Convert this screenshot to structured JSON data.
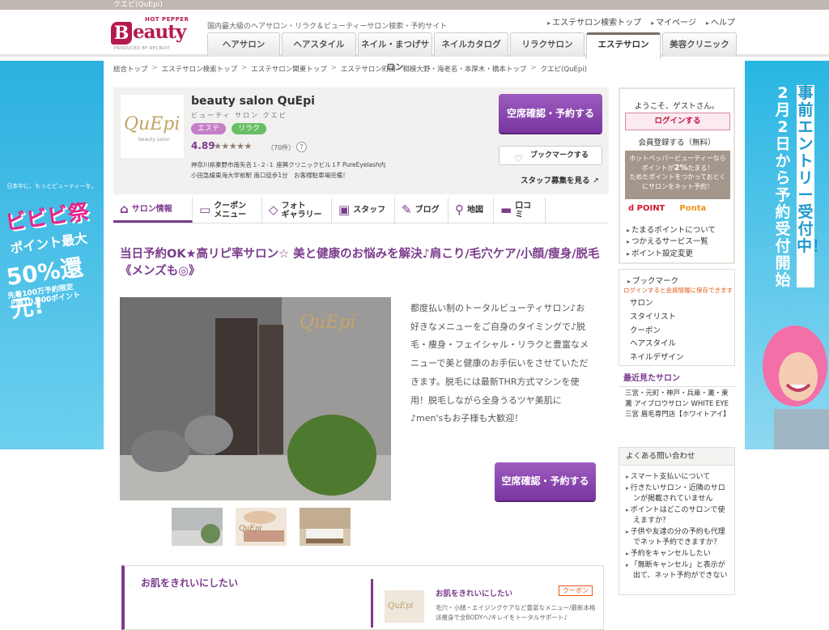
{
  "topbar": {
    "title": "クエピ(QuEpi)"
  },
  "header": {
    "logo": {
      "hotpepper": "HOT PEPPER",
      "b": "B",
      "eauty": "eauty",
      "produced": "PRODUCED BY RECRUIT"
    },
    "tagline": "国内最大級のヘアサロン・リラク＆ビューティーサロン検索・予約サイト",
    "links": [
      "エステサロン検索トップ",
      "マイページ",
      "ヘルプ"
    ],
    "tabs": [
      {
        "label": "ヘアサロン",
        "active": false
      },
      {
        "label": "ヘアスタイル",
        "active": false
      },
      {
        "label": "ネイル・まつげサロン",
        "active": false
      },
      {
        "label": "ネイルカタログ",
        "active": false
      },
      {
        "label": "リラクサロン",
        "active": false
      },
      {
        "label": "エステサロン",
        "active": true
      },
      {
        "label": "美容クリニック",
        "active": false
      }
    ]
  },
  "breadcrumb": [
    "総合トップ",
    "エステサロン検索トップ",
    "エステサロン関東トップ",
    "エステサロン町田・相模大野・海老名・本厚木・橋本トップ",
    "クエピ(QuEpi)"
  ],
  "salon": {
    "logo_text": "QuEpi",
    "logo_sub": "beauty salon",
    "name": "beauty salon QuEpi",
    "kana": "ビューティ サロン クエピ",
    "tags": [
      "エステ",
      "リラク"
    ],
    "rating": "4.89",
    "stars": "★★★★★",
    "reviews": "（70件）",
    "help": "?",
    "address": "神奈川県秦野市南矢名１-２-１ 座興クリニックビル１F PureEyelash内",
    "access": "小田急線東海大学前駅 南口徒歩1分　お客様駐車場完備！",
    "reserve_label": "空席確認・予約する",
    "bookmark_label": "ブックマークする",
    "staff_link": "スタッフ募集を見る"
  },
  "subnav": [
    {
      "label": "サロン情報",
      "icon": "home-icon",
      "glyph": "⌂",
      "active": true
    },
    {
      "label": "クーポン\nメニュー",
      "icon": "coupon-icon",
      "glyph": "▭",
      "active": false
    },
    {
      "label": "フォト\nギャラリー",
      "icon": "photo-icon",
      "glyph": "◇",
      "active": false
    },
    {
      "label": "スタッフ",
      "icon": "staff-icon",
      "glyph": "▣",
      "active": false
    },
    {
      "label": "ブログ",
      "icon": "pencil-icon",
      "glyph": "✎",
      "active": false
    },
    {
      "label": "地図",
      "icon": "map-pin-icon",
      "glyph": "⚲",
      "active": false
    },
    {
      "label": "口コミ",
      "icon": "speech-bubble-icon",
      "glyph": "▬",
      "active": false
    }
  ],
  "headline": "当日予約OK★高リピ率サロン☆ 美と健康のお悩みを解決♪肩こり/毛穴ケア/小顔/痩身/脱毛《メンズも◎》",
  "description": "都度払い制のトータルビューティサロン♪お好きなメニューをご自身のタイミングで♪脱毛・痩身・フェイシャル・リラクと豊富なメニューで美と健康のお手伝いをさせていただきます。脱毛には最新THR方式マシンを使用！脱毛しながら全身うるツヤ美肌に♪men'sもお子様も大歓迎！",
  "reserve_label_2": "空席確認・予約する",
  "feature": {
    "title": "お肌をきれいにしたい",
    "card_title": "お肌をきれいにしたい",
    "badge": "クーポン",
    "card_desc": "毛穴・小顔・エイジングケアなど豊富なメニュー/最新本格派痩身で全BODYへ/キレイをトータルサポート♪",
    "img_text": "QuEpi"
  },
  "sidebar": {
    "welcome": "ようこそ、ゲストさん。",
    "login": "ログインする",
    "register": "会員登録する（無料）",
    "points_line1": "ホットペッパービューティーなら",
    "points_line2": "ポイントが",
    "points_pct": "2%",
    "points_line3": "たまる！",
    "points_line4": "ためたポイントをつかっておとく",
    "points_line5": "にサロンをネット予約！",
    "dpoint": "d POINT",
    "ponta": "Ponta",
    "links": [
      "たまるポイントについて",
      "つかえるサービス一覧",
      "ポイント設定変更"
    ],
    "bookmark_title": "ブックマーク",
    "bookmark_note": "ログインすると会員情報に保存できます",
    "bookmark_items": [
      "サロン",
      "スタイリスト",
      "クーポン",
      "ヘアスタイル",
      "ネイルデザイン"
    ],
    "recent_title": "最近見たサロン",
    "recent_text": "三宮・元町・神戸・兵庫・灘・東灘 アイブロウサロン WHITE EYE 三宮 眉毛専門店【ホワイトアイ】",
    "faq_title": "よくある問い合わせ",
    "faq": [
      "スマート支払いについて",
      "行きたいサロン・近隣のサロンが掲載されていません",
      "ポイントはどこのサロンで使えますか？",
      "子供や友達の分の予約も代理でネット予約できますか？",
      "予約をキャンセルしたい",
      "「無断キャンセル」と表示が出て、ネット予約ができない"
    ]
  },
  "banner_left": {
    "top": "日本中に、もっとビューティーを。",
    "big": "ビビビ祭",
    "pt1": "ポイント最大",
    "pt2": "50%還元!",
    "pt3a": "先着100万予約限定",
    "pt3b": "上限10,000ポイント"
  },
  "banner_right": {
    "col1": "事前エントリー受付中！",
    "col2": "2月2日から予約受付開始"
  },
  "thumbnails": [
    "thumb-1",
    "thumb-2",
    "thumb-3"
  ]
}
